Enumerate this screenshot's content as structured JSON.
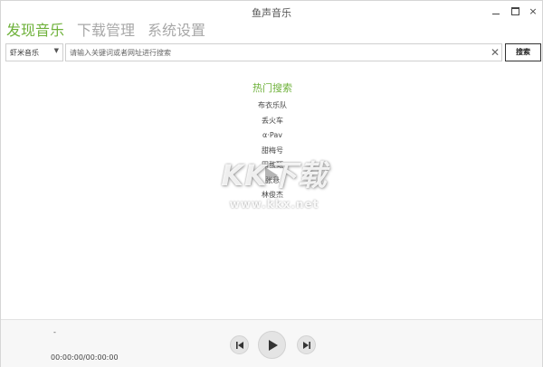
{
  "window": {
    "title": "鱼声音乐",
    "controls": {
      "minimize": "minimize-icon",
      "maximize": "maximize-icon",
      "close": "×"
    }
  },
  "tabs": [
    {
      "label": "发现音乐",
      "active": true
    },
    {
      "label": "下载管理",
      "active": false
    },
    {
      "label": "系统设置",
      "active": false
    }
  ],
  "search": {
    "source": "虾米音乐",
    "placeholder": "请输入关键词或者网址进行搜索",
    "value": "",
    "clear_label": "✕",
    "button_label": "搜索"
  },
  "hot": {
    "title": "热门搜索",
    "items": [
      "布衣乐队",
      "丢火车",
      "α·Pav",
      "甜梅号",
      "田馥甄",
      "张悬",
      "林俊杰"
    ]
  },
  "watermark": {
    "text": "KK下载",
    "url": "www.kkx.net"
  },
  "player": {
    "song": "-",
    "time": "00:00:00/00:00:00",
    "controls": [
      "previous-icon",
      "play-icon",
      "next-icon"
    ]
  },
  "colors": {
    "accent": "#6eb13a",
    "inactive_tab": "#a8a8a8",
    "player_bg": "#f7f7f7"
  }
}
